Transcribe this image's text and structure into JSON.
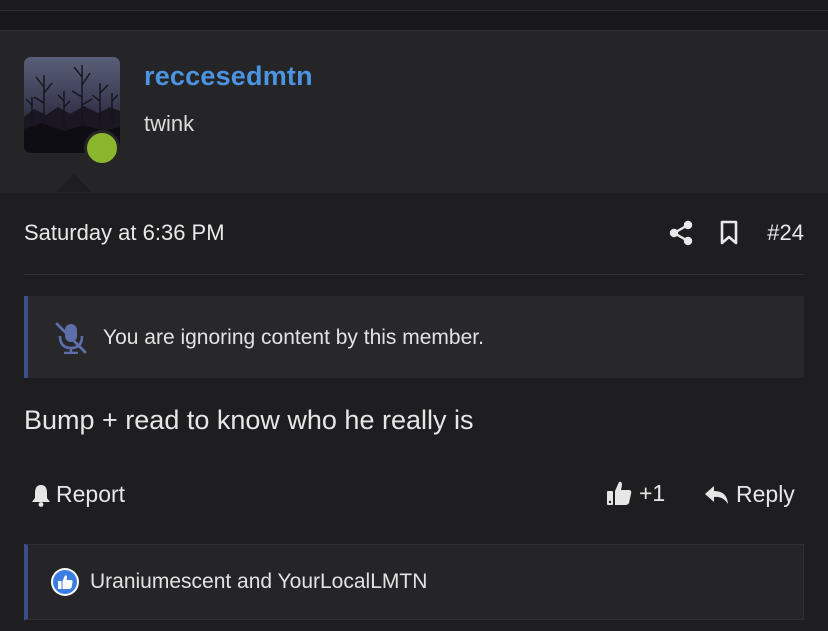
{
  "user": {
    "username": "reccesedmtn",
    "title": "twink",
    "online_color": "#8ab62e"
  },
  "post": {
    "timestamp": "Saturday at 6:36 PM",
    "number": "#24",
    "ignore_notice": "You are ignoring content by this member.",
    "body": "Bump + read to know who he really is"
  },
  "actions": {
    "report_label": "Report",
    "like_count": "+1",
    "reply_label": "Reply"
  },
  "reactions": {
    "users": "Uraniumescent and YourLocalLMTN"
  },
  "icons": {
    "share": "share-icon",
    "bookmark": "bookmark-icon",
    "ignore": "muted-microphone-icon",
    "report": "bell-icon",
    "like": "thumbs-up-icon",
    "reply": "reply-arrow-icon",
    "reaction": "like-reaction-icon"
  },
  "colors": {
    "username": "#4c93e0",
    "accent_border": "#3d4f8a",
    "background": "#1e1e20",
    "reaction_blue": "#3b7de0"
  }
}
